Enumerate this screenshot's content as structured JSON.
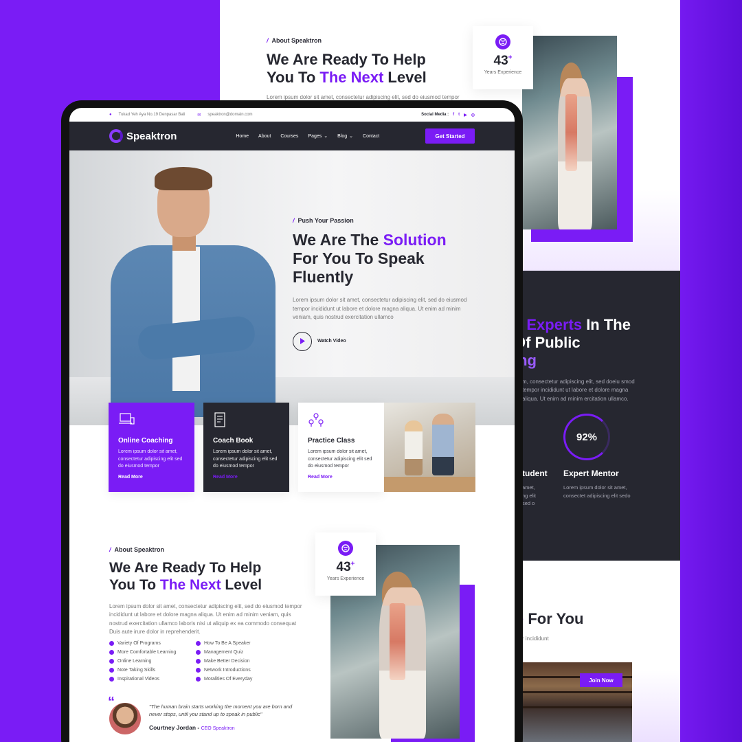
{
  "colors": {
    "accent": "#7a1cf5",
    "dark": "#262730",
    "bg": "#7a1cf5"
  },
  "back_page": {
    "about": {
      "tag": "About Speaktron",
      "title_line1": "We Are Ready To Help",
      "title_line2_pre": "You To ",
      "title_line2_accent": "The Next",
      "title_line2_post": " Level",
      "paragraph": "Lorem ipsum dolor sit amet, consectetur adipiscing elit, sed do eiusmod tempor",
      "experience_number": "43",
      "experience_plus": "+",
      "experience_label": "Years Experience"
    },
    "experts": {
      "title_line1_pre": "e ",
      "title_line1_accent": "Experts",
      "title_line1_post": " In The",
      "title_line2": "Of Public",
      "title_line3": "ing",
      "paragraph": "m, consectetur adipiscing elit, sed doeiu smod tempor incididunt ut labore et dolore magna aliqua. Ut enim ad minim ercitation ullamco.",
      "stat_percent": "92%",
      "stat_left_title": "tudent",
      "stat_left_desc_1": "amet,",
      "stat_left_desc_2": "ng elit",
      "stat_left_desc_3": "sed o",
      "stat_title": "Expert Mentor",
      "stat_desc": "Lorem ipsum dolor sit amet, consectet adipiscing elit sedo"
    },
    "for_you": {
      "title_pre": "e ",
      "title_accent": "For You",
      "paragraph": "r incididunt",
      "join_label": "Join Now"
    }
  },
  "topbar": {
    "address": "Tukad Yeh Aya No.19 Denpasar Bali",
    "email": "speaktron@domain.com",
    "social_label": "Social Media :"
  },
  "nav": {
    "logo": "Speaktron",
    "items": [
      "Home",
      "About",
      "Courses",
      "Pages",
      "Blog",
      "Contact"
    ],
    "cta": "Get Started"
  },
  "hero": {
    "tag": "Push Your Passion",
    "title_pre": "We Are The ",
    "title_accent": "Solution",
    "title_line2": "For You To Speak",
    "title_line3": "Fluently",
    "paragraph": "Lorem ipsum dolor sit amet, consectetur adipiscing elit, sed do eiusmod tempor incididunt ut labore et dolore magna aliqua. Ut enim ad minim veniam, quis nostrud exercitation ullamco",
    "watch": "Watch Video"
  },
  "cards": [
    {
      "title": "Online Coaching",
      "text": "Lorem ipsum dolor sit amet, consectetur adipiscing elit sed do eiusmod tempor",
      "link": "Read More",
      "icon": "laptop-icon"
    },
    {
      "title": "Coach Book",
      "text": "Lorem ipsum dolor sit amet, consectetur adipiscing elit sed do eiusmod tempor",
      "link": "Read More",
      "icon": "book-icon"
    },
    {
      "title": "Practice Class",
      "text": "Lorem ipsum dolor sit amet, consectetur adipiscing elit sed do eiusmod tempor",
      "link": "Read More",
      "icon": "team-icon"
    }
  ],
  "about": {
    "tag": "About Speaktron",
    "title_line1": "We Are Ready To Help",
    "title_line2_pre": "You To ",
    "title_line2_accent": "The Next",
    "title_line2_post": " Level",
    "paragraph": "Lorem ipsum dolor sit amet, consectetur adipiscing elit, sed do eiusmod tempor incididunt ut labore et dolore magna aliqua. Ut enim ad minim veniam, quis nostrud exercitation ullamco laboris nisi ut aliquip ex ea commodo consequat Duis aute irure dolor in reprehenderit.",
    "bullets": [
      "Variety Of Programs",
      "How To Be A Speaker",
      "More Comfortable Learning",
      "Management Quiz",
      "Online Learning",
      "Make Better Decision",
      "Note Taking Skills",
      "Network Introductions",
      "Inspirational Videos",
      "Moralities Of Everyday"
    ],
    "experience_number": "43",
    "experience_plus": "+",
    "experience_label": "Years Experience",
    "quote": "\"The human brain starts working the moment you are born and never stops, until you stand up to speak in public\"",
    "quote_name": "Courtney Jordan",
    "quote_dash": " - ",
    "quote_role": "CEO Speaktron"
  }
}
